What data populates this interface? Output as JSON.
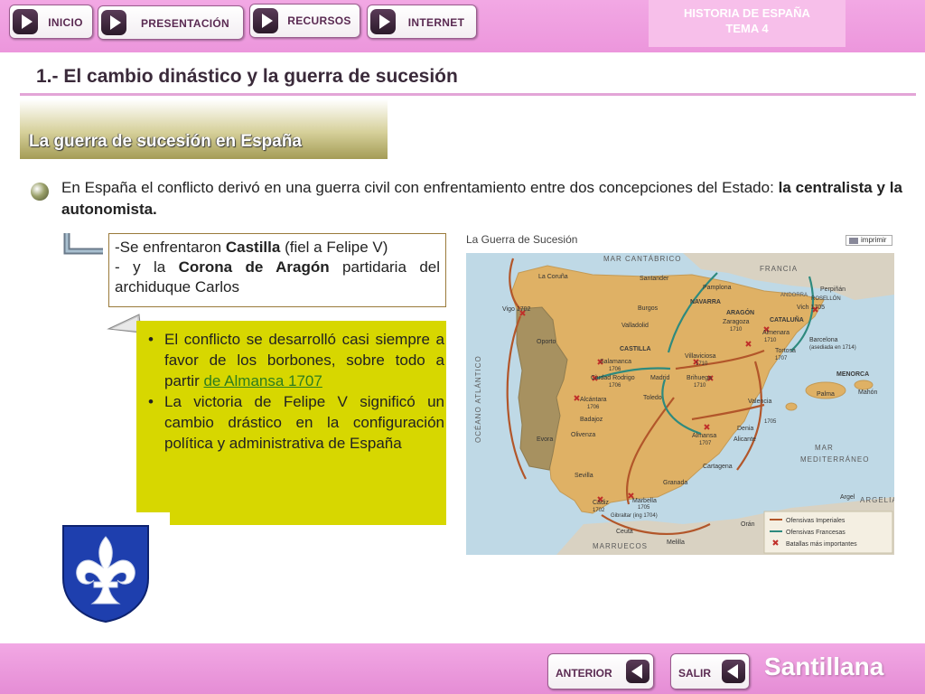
{
  "nav": {
    "buttons": [
      {
        "label": "INICIO"
      },
      {
        "label": "PRESENTACIÓN"
      },
      {
        "label": "RECURSOS"
      },
      {
        "label": "INTERNET"
      }
    ],
    "tema_line1": "HISTORIA DE ESPAÑA",
    "tema_line2": "TEMA 4"
  },
  "page": {
    "title": "1.- El cambio dinástico y la guerra de sucesión",
    "subtitle": "La guerra de sucesión en España",
    "intro_part1": "En España el conflicto derivó en una guerra civil con enfrentamiento entre dos concepciones del Estado: ",
    "intro_bold": "la centralista y la autonomista."
  },
  "box1": {
    "line1_prefix": "-Se enfrentaron ",
    "line1_bold": "Castilla",
    "line1_suffix": " (fiel a Felipe V)",
    "line2_prefix": "- y la ",
    "line2_bold": "Corona de Aragón",
    "line2_suffix": " partidaria del archiduque Carlos"
  },
  "list": {
    "bullet": "•",
    "item1_text": "El conflicto se desarrolló casi siempre a favor de los borbones, sobre todo a partir ",
    "item1_link": "de Almansa 1707",
    "item2_text": "La victoria de Felipe V significó un cambio drástico en la configuración política y administrativa de España"
  },
  "map": {
    "title": "La Guerra de Sucesión",
    "print_label": "imprimir",
    "labels": {
      "mar_cantabrico": "MAR CANTÁBRICO",
      "francia": "FRANCIA",
      "oceano": "OCÉANO ATLÁNTICO",
      "mar_med_1": "MAR",
      "mar_med_2": "MEDITERRÁNEO",
      "marruecos": "MARRUECOS",
      "argelia": "ARGELIA",
      "andorra": "ANDORRA",
      "navarra": "NAVARRA",
      "aragon": "ARAGÓN",
      "cataluna": "CATALUÑA",
      "castilla": "CASTILLA",
      "menorca": "MENORCA"
    },
    "cities": {
      "la_coruna": "La Coruña",
      "santander": "Santander",
      "pamplona": "Pamplona",
      "perpinan": "Perpiñán",
      "rosellon": "ROSELLÓN",
      "vigo": "Vigo 1702",
      "burgos": "Burgos",
      "zaragoza": "Zaragoza",
      "zaragoza_year": "1710",
      "vich": "Vich 1705",
      "valladolid": "Valladolid",
      "almenara": "Almenara",
      "almenara_year": "1710",
      "oporto": "Oporto",
      "barcelona": "Barcelona",
      "barcelona_note": "(asediada en 1714)",
      "tortosa": "Tortosa",
      "tortosa_year": "1707",
      "villaviciosa": "Villaviciosa",
      "villaviciosa_year": "1710",
      "salamanca": "Salamanca",
      "salamanca_year": "1706",
      "madrid": "Madrid",
      "ciudad_rodrigo": "Ciudad Rodrigo",
      "ciudad_rodrigo_year": "1706",
      "brihuega": "Brihuega",
      "brihuega_year": "1710",
      "palma": "Palma",
      "mahon": "Mahón",
      "toledo": "Toledo",
      "alcantara": "Alcántara",
      "alcantara_year": "1706",
      "valencia": "Valencia",
      "badajoz": "Badajoz",
      "olivenza": "Olivenza",
      "evora": "Evora",
      "denia": "Denia",
      "y1705": "1705",
      "almansa": "Almansa",
      "almansa_year": "1707",
      "alicante": "Alicante",
      "cartagena": "Cartagena",
      "sevilla": "Sevilla",
      "granada": "Granada",
      "cadiz": "Cádiz",
      "cadiz_year": "1702",
      "marbella": "Marbella",
      "marbella_year": "1705",
      "gibraltar": "Gibraltar (ing 1704)",
      "argel": "Argel",
      "ceuta": "Ceuta",
      "oran": "Orán",
      "melilla": "Melilla"
    },
    "legend": [
      {
        "label": "Ofensivas Imperiales",
        "color": "#b2562a"
      },
      {
        "label": "Ofensivas Francesas",
        "color": "#2e8a7e"
      },
      {
        "label": "Batallas más importantes",
        "color": "#c0302a"
      }
    ]
  },
  "footer": {
    "anterior": "ANTERIOR",
    "salir": "SALIR",
    "brand": "Santillana"
  }
}
